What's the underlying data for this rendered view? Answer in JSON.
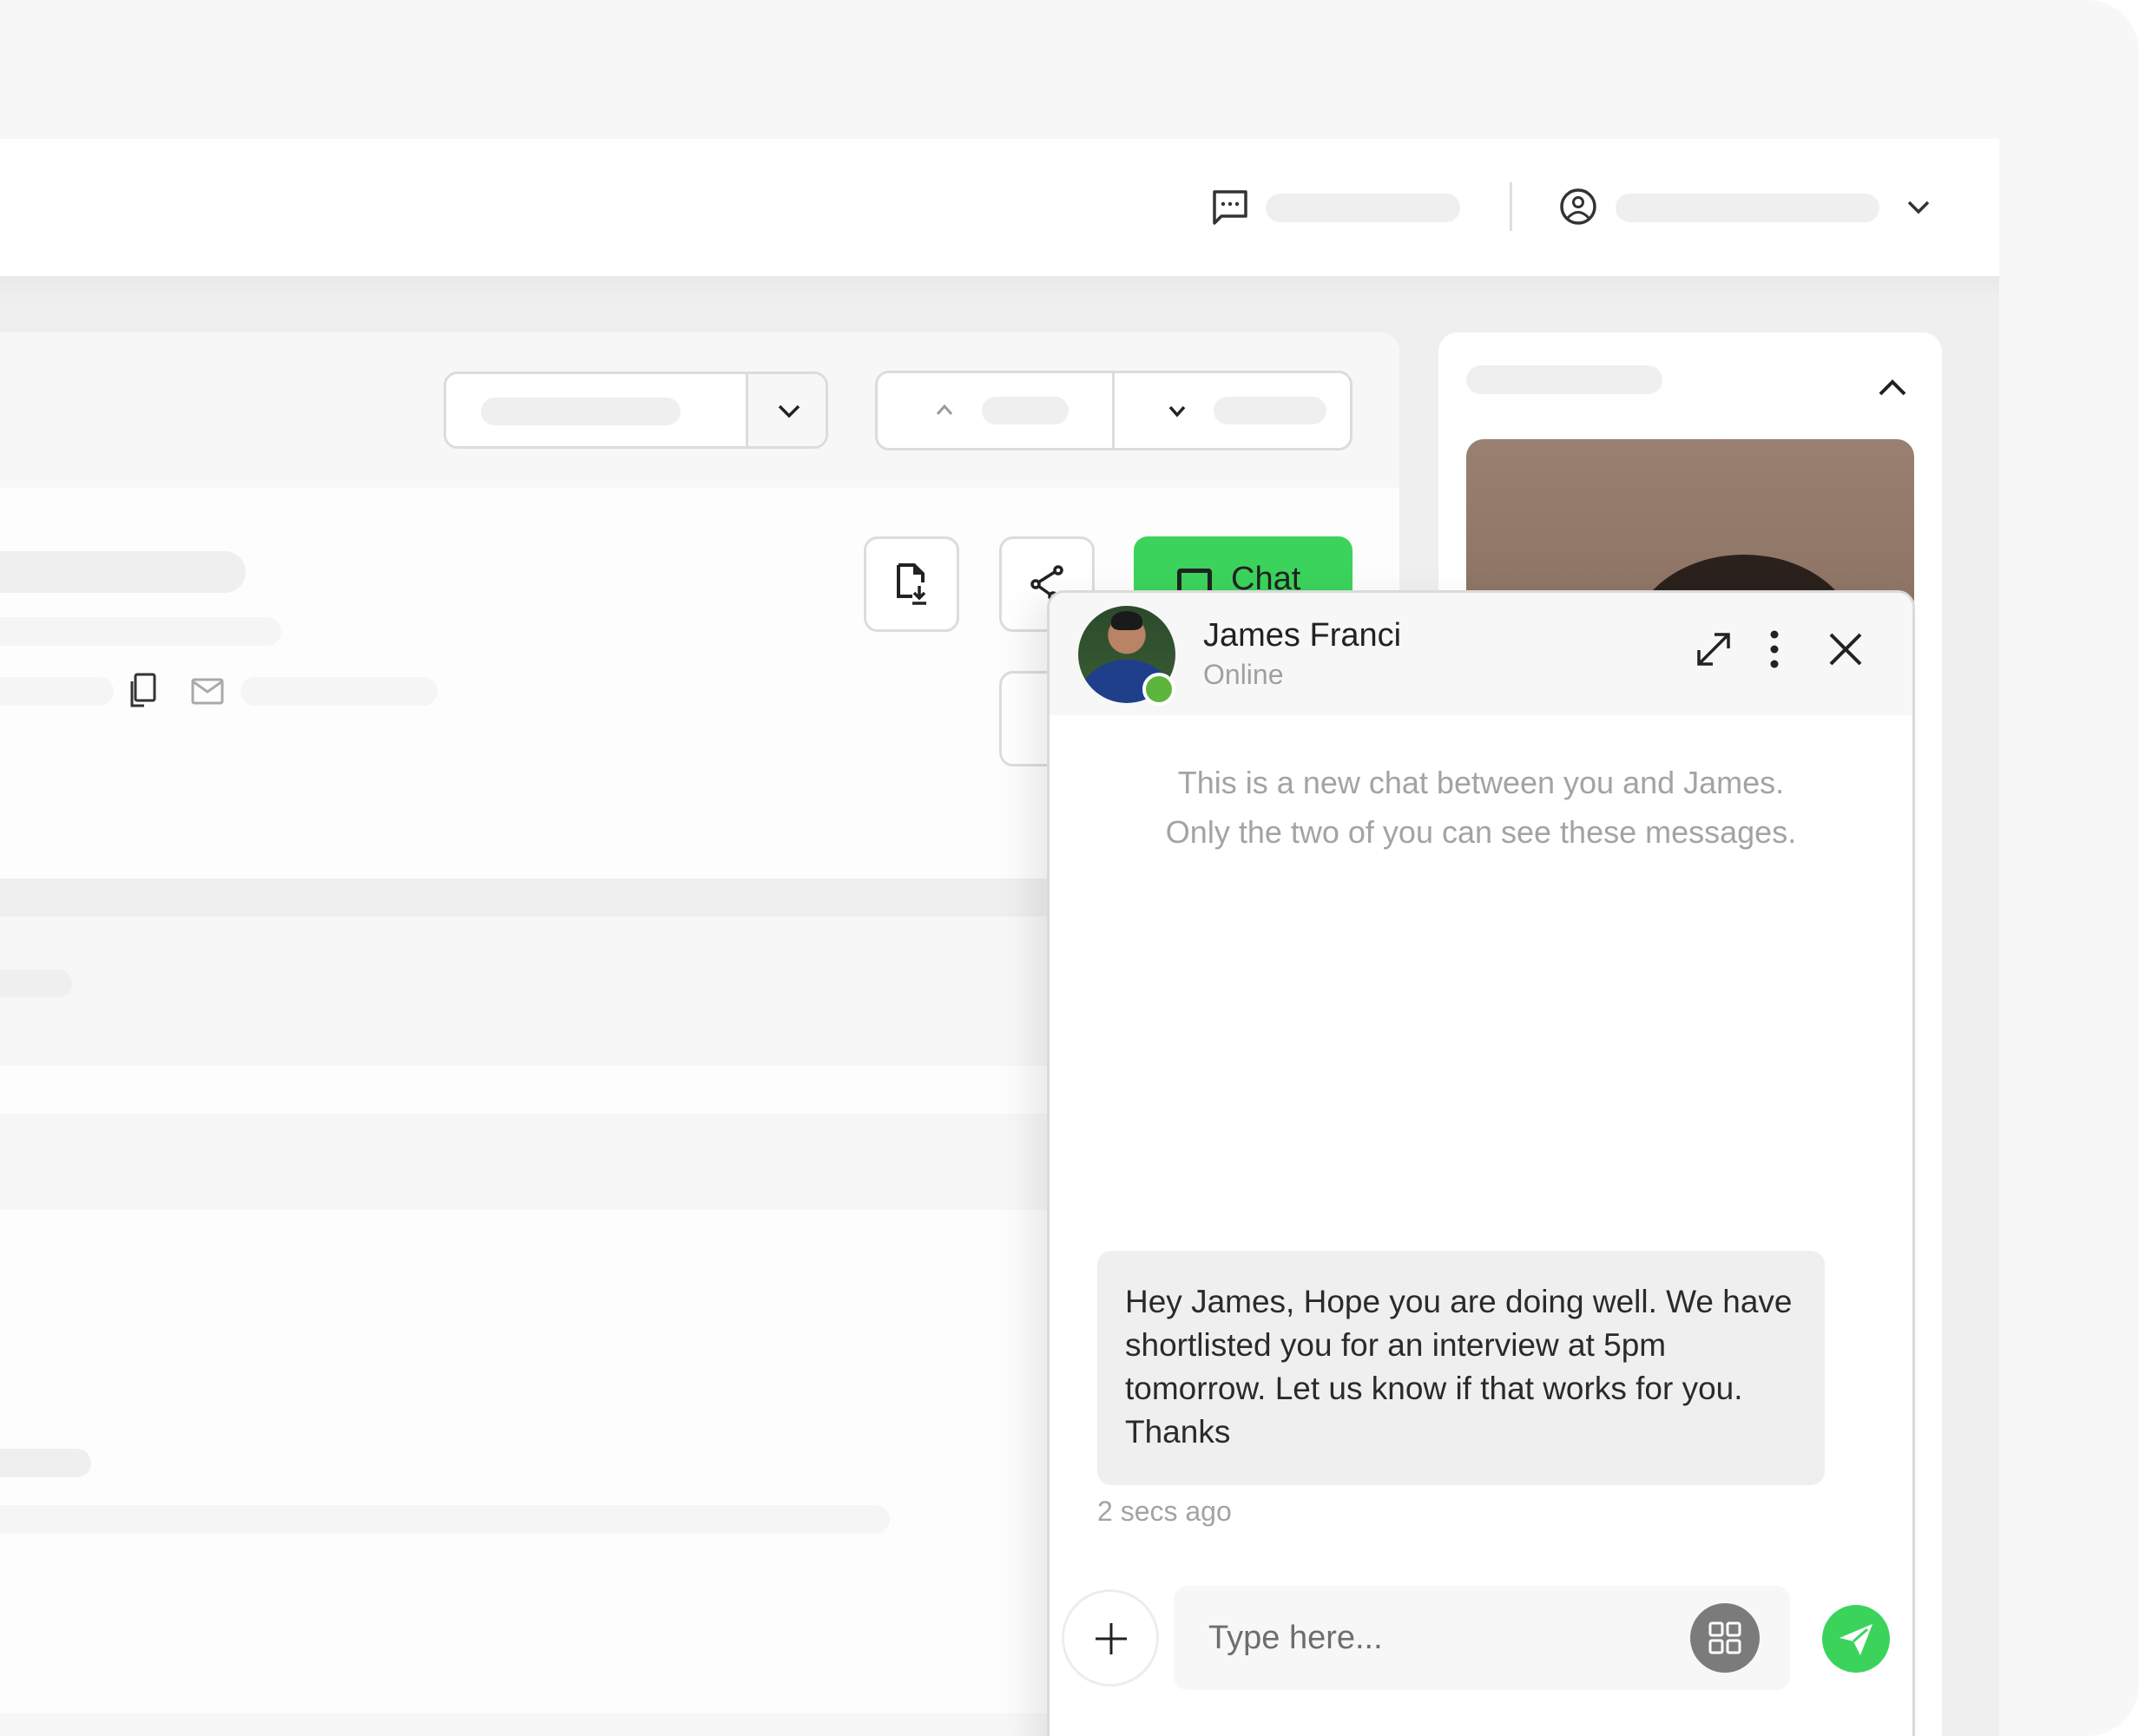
{
  "header": {
    "messages_icon": "chat-bubble-dots-icon",
    "profile_icon": "user-circle-icon",
    "profile_chevron_icon": "chevron-down-icon"
  },
  "toolbar": {
    "dropdown1_chevron": "chevron-down-icon",
    "sort_up_icon": "chevron-up-icon",
    "sort_down_icon": "chevron-down-icon"
  },
  "actions": {
    "download_icon": "file-download-icon",
    "share_icon": "share-icon",
    "chat_label": "Chat",
    "chat_icon": "chat-square-icon"
  },
  "contact_row": {
    "copy_icon": "copy-icon",
    "mail_icon": "mail-icon"
  },
  "side_panel": {
    "collapse_icon": "chevron-up-icon"
  },
  "chat": {
    "contact_name": "James Franci",
    "status": "Online",
    "status_color": "#5db53b",
    "expand_icon": "expand-arrows-icon",
    "more_icon": "more-vertical-icon",
    "close_icon": "close-icon",
    "intro_line1": "This is a new chat between you and James.",
    "intro_line2": "Only the two of you can see these messages.",
    "messages": [
      {
        "text": "Hey James, Hope you are doing well. We have shortlisted you for an interview at 5pm tomorrow. Let us know if that works for you. Thanks",
        "time": "2 secs ago"
      }
    ],
    "input_placeholder": "Type here...",
    "input_value": "",
    "attach_icon": "plus-icon",
    "apps_icon": "grid-icon",
    "send_icon": "send-icon",
    "accent_color": "#3bd35c"
  }
}
